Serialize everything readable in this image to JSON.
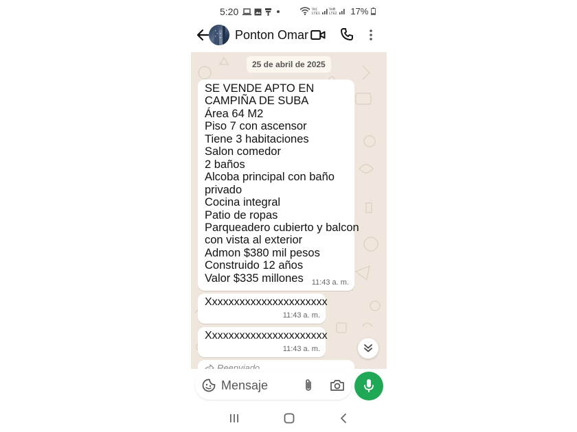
{
  "status_bar": {
    "time": "5:20",
    "battery": "17%"
  },
  "header": {
    "contact_name": "Ponton Omar"
  },
  "chat": {
    "date_chip": "25 de abril de 2025",
    "messages": [
      {
        "lines": [
          "SE VENDE APTO EN",
          "CAMPIÑA DE SUBA",
          "Área 64 M2",
          "Piso 7 con ascensor",
          "Tiene 3 habitaciones",
          "Salon comedor",
          "2 baños",
          "Alcoba principal con baño",
          "privado",
          "Cocina integral",
          "Patio de ropas",
          "Parqueadero cubierto y balcon",
          "con vista al exterior",
          "Admon $380 mil pesos",
          "Construido 12 años",
          "Valor $335 millones"
        ],
        "time": "11:43 a. m."
      },
      {
        "text": "Xxxxxxxxxxxxxxxxxxxxxx",
        "time": "11:43 a. m."
      },
      {
        "text": "Xxxxxxxxxxxxxxxxxxxxxx",
        "time": "11:43 a. m."
      },
      {
        "forwarded_label": "Reenviado"
      }
    ]
  },
  "composer": {
    "placeholder": "Mensaje"
  },
  "colors": {
    "chat_background": "#efe7dd",
    "mic_button": "#1fa855",
    "bubble": "#ffffff"
  }
}
